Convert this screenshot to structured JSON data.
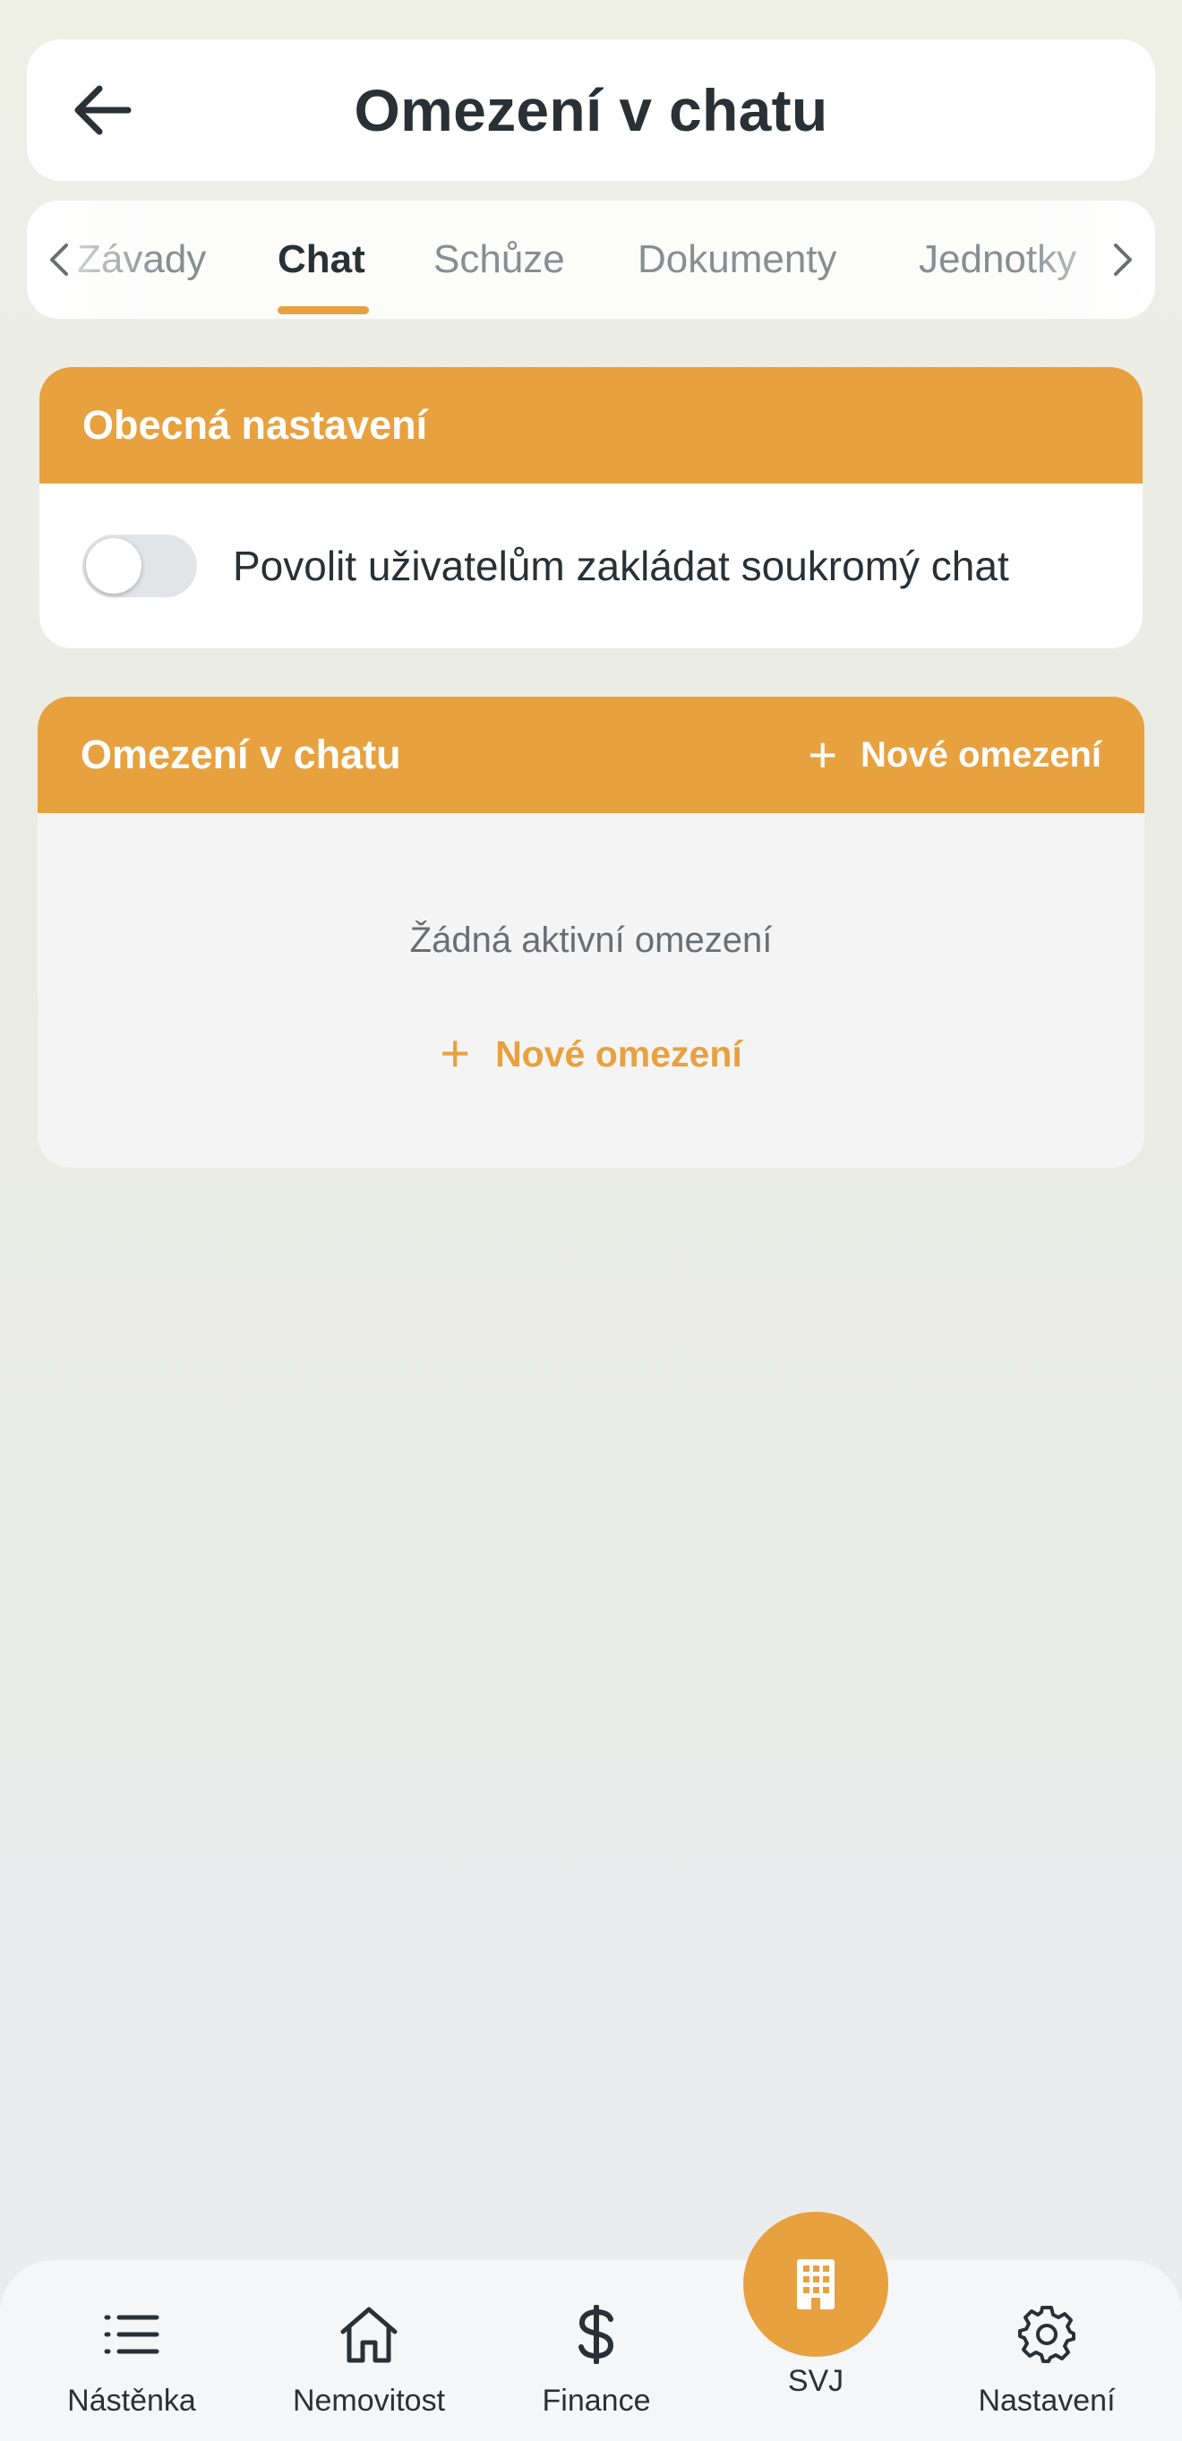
{
  "header": {
    "title": "Omezení v chatu"
  },
  "tabs": [
    {
      "label": "Závady",
      "active": false
    },
    {
      "label": "Chat",
      "active": true
    },
    {
      "label": "Schůze",
      "active": false
    },
    {
      "label": "Dokumenty",
      "active": false
    },
    {
      "label": "Jednotky",
      "active": false
    }
  ],
  "general_settings": {
    "title": "Obecná nastavení",
    "toggle_label": "Povolit uživatelům zakládat soukromý chat",
    "toggle_on": false
  },
  "restrictions": {
    "title": "Omezení v chatu",
    "new_button_label": "Nové omezení",
    "empty_text": "Žádná aktivní omezení",
    "new_button_body_label": "Nové omezení"
  },
  "bottom_nav": {
    "items": [
      {
        "label": "Nástěnka",
        "icon": "list-icon"
      },
      {
        "label": "Nemovitost",
        "icon": "house-icon"
      },
      {
        "label": "Finance",
        "icon": "dollar-icon"
      },
      {
        "label": "SVJ",
        "icon": "building-icon"
      },
      {
        "label": "Nastavení",
        "icon": "gear-icon"
      }
    ]
  },
  "colors": {
    "accent": "#e8a13f",
    "text": "#2b3034",
    "muted": "#8a8d90"
  }
}
